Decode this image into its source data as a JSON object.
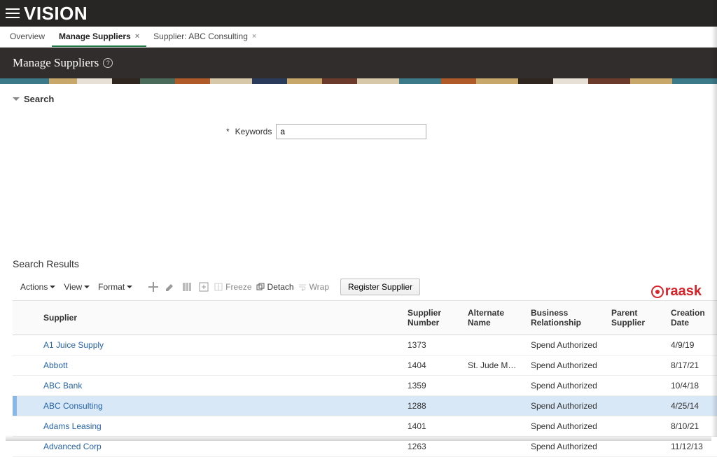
{
  "brand": "VISION",
  "tabs": [
    {
      "label": "Overview",
      "closable": false,
      "active": false
    },
    {
      "label": "Manage Suppliers",
      "closable": true,
      "active": true
    },
    {
      "label": "Supplier: ABC Consulting",
      "closable": true,
      "active": false
    }
  ],
  "page": {
    "title": "Manage Suppliers"
  },
  "search": {
    "section_label": "Search",
    "keywords_label": "Keywords",
    "required_mark": "*",
    "keywords_value": "a"
  },
  "results": {
    "title": "Search Results",
    "menus": {
      "actions": "Actions",
      "view": "View",
      "format": "Format"
    },
    "toolbar": {
      "freeze": "Freeze",
      "detach": "Detach",
      "wrap": "Wrap",
      "register": "Register Supplier"
    },
    "columns": {
      "supplier": "Supplier",
      "number": "Supplier Number",
      "alt_name": "Alternate Name",
      "relationship": "Business Relationship",
      "parent": "Parent Supplier",
      "created": "Creation Date"
    },
    "rows": [
      {
        "supplier": "A1 Juice Supply",
        "number": "1373",
        "alt_name": "",
        "relationship": "Spend Authorized",
        "parent": "",
        "created": "4/9/19",
        "selected": false
      },
      {
        "supplier": "Abbott",
        "number": "1404",
        "alt_name": "St. Jude Medica...",
        "relationship": "Spend Authorized",
        "parent": "",
        "created": "8/17/21",
        "selected": false
      },
      {
        "supplier": "ABC Bank",
        "number": "1359",
        "alt_name": "",
        "relationship": "Spend Authorized",
        "parent": "",
        "created": "10/4/18",
        "selected": false
      },
      {
        "supplier": "ABC Consulting",
        "number": "1288",
        "alt_name": "",
        "relationship": "Spend Authorized",
        "parent": "",
        "created": "4/25/14",
        "selected": true
      },
      {
        "supplier": "Adams Leasing",
        "number": "1401",
        "alt_name": "",
        "relationship": "Spend Authorized",
        "parent": "",
        "created": "8/10/21",
        "selected": false
      },
      {
        "supplier": "Advanced Corp",
        "number": "1263",
        "alt_name": "",
        "relationship": "Spend Authorized",
        "parent": "",
        "created": "11/12/13",
        "selected": false
      }
    ]
  },
  "watermark": "raask"
}
